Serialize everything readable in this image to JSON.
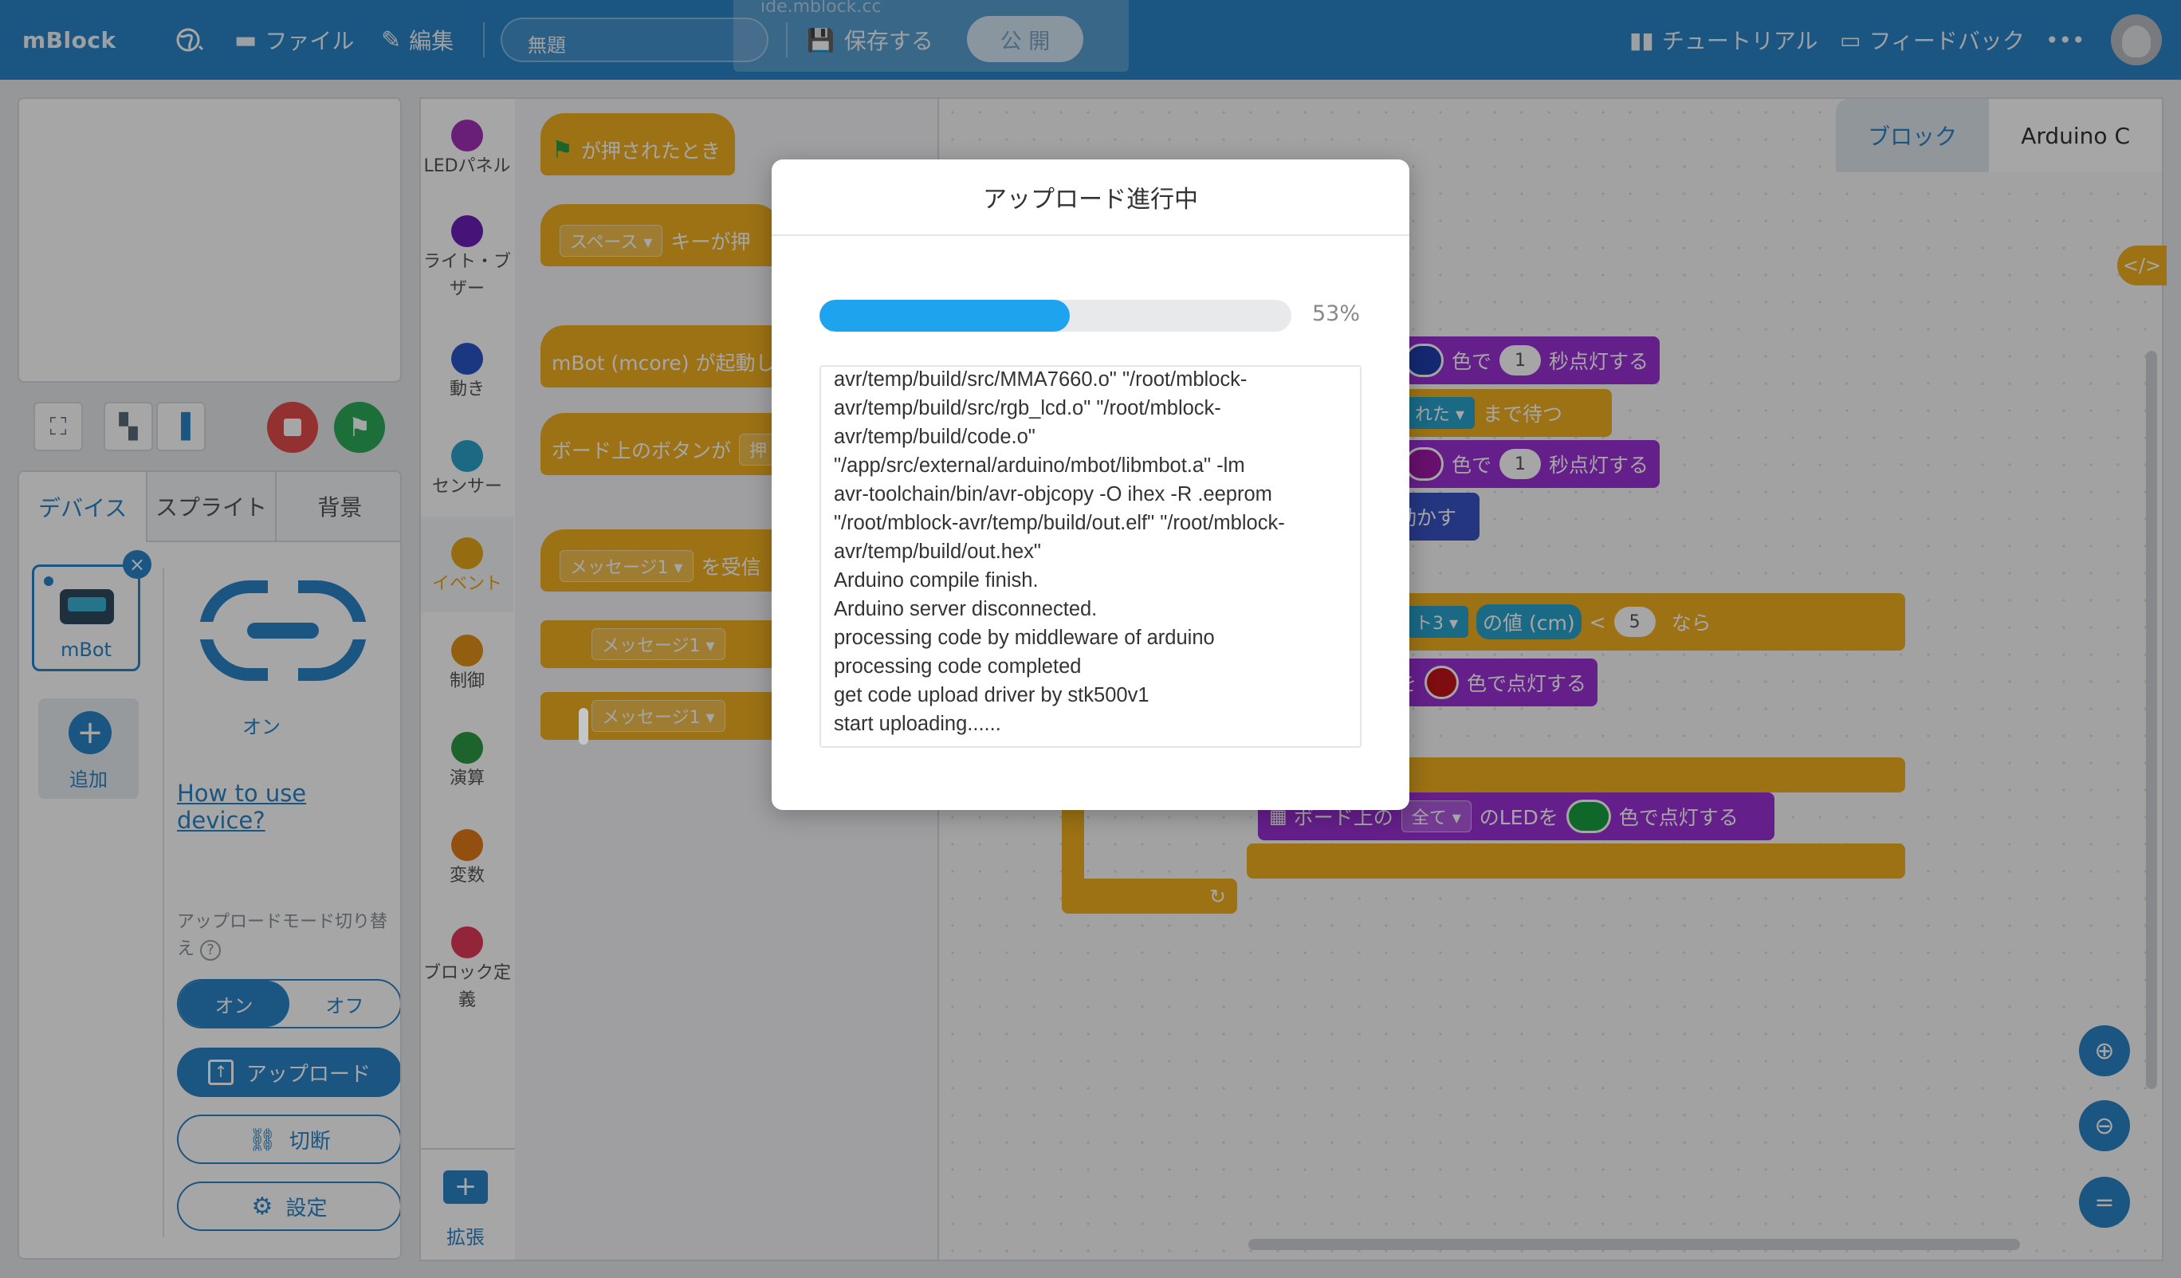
{
  "topbar": {
    "logo": "mBlock",
    "url_hint": "ide.mblock.cc",
    "file_menu": "ファイル",
    "edit_menu": "編集",
    "project_title": "無題",
    "save": "保存する",
    "publish": "公 開",
    "tutorial": "チュートリアル",
    "feedback": "フィードバック",
    "more": "•••"
  },
  "device_panel": {
    "tabs": [
      "デバイス",
      "スプライト",
      "背景"
    ],
    "device_name": "mBot",
    "add_label": "追加",
    "connection_status": "オン",
    "howto_link": "How to use device?",
    "upload_mode_label": "アップロードモード切り替え",
    "toggle_on": "オン",
    "toggle_off": "オフ",
    "upload_button": "アップロード",
    "disconnect_button": "切断",
    "settings_button": "設定"
  },
  "categories": [
    {
      "label": "LEDパネル",
      "color": "#a230b8"
    },
    {
      "label": "ライト・ブザー",
      "color": "#6c1fb8"
    },
    {
      "label": "動き",
      "color": "#2b55c6"
    },
    {
      "label": "センサー",
      "color": "#2aa2c9"
    },
    {
      "label": "イベント",
      "color": "#e6a71a"
    },
    {
      "label": "制御",
      "color": "#e0931a"
    },
    {
      "label": "演算",
      "color": "#2b9a44"
    },
    {
      "label": "変数",
      "color": "#e07a1a"
    },
    {
      "label": "ブロック定義",
      "color": "#e23a5a"
    }
  ],
  "extension_label": "拡張",
  "palette_blocks": {
    "flag_clicked": "が押されたとき",
    "key_dropdown": "スペース ▾",
    "key_pressed": "キーが押",
    "mbot_start": "mBot (mcore) が起動し",
    "board_button": "ボード上のボタンが",
    "board_button_tail": "押",
    "message_received": "メッセージ1 ▾",
    "message_received_tail": "を受信",
    "broadcast_1": "メッセージ1 ▾",
    "broadcast_2": "メッセージ1 ▾"
  },
  "workspace": {
    "tab_blocks": "ブロック",
    "tab_code": "Arduino C",
    "b1_color_text": "色で",
    "b1_num": "1",
    "b1_tail": "秒点灯する",
    "b2_dd": "れた ▾",
    "b2_tail": "まで待つ",
    "b3_color_text": "色で",
    "b3_num": "1",
    "b3_tail": "秒点灯する",
    "b4": "動かす",
    "b5_dd": "ト3 ▾",
    "b5_val": "の値 (cm)",
    "b5_op": "<",
    "b5_num": "5",
    "b5_tail": "なら",
    "b6_pre": "を",
    "b6_tail": "色で点灯する",
    "b7_pre": "ボード上の",
    "b7_dd": "全て ▾",
    "b7_mid": "のLEDを",
    "b7_tail": "色で点灯する"
  },
  "upload_dialog": {
    "title": "アップロード進行中",
    "progress": 0.53,
    "progress_text": "53%",
    "log_lines": [
      "avr/temp/build/src/MMA7660.o\" \"/root/mblock-",
      "avr/temp/build/src/rgb_lcd.o\" \"/root/mblock-",
      "avr/temp/build/code.o\"",
      "\"/app/src/external/arduino/mbot/libmbot.a\" -lm",
      "avr-toolchain/bin/avr-objcopy -O ihex -R .eeprom",
      "\"/root/mblock-avr/temp/build/out.elf\" \"/root/mblock-",
      "avr/temp/build/out.hex\"",
      "Arduino compile finish.",
      "Arduino server disconnected.",
      "processing code by middleware of arduino",
      "processing code completed",
      "get code upload driver by stk500v1",
      "start uploading......"
    ]
  },
  "colors": {
    "brand": "#2a83c6",
    "progress": "#1ea3ef",
    "event": "#f0b020",
    "looks": "#9b30d6"
  }
}
